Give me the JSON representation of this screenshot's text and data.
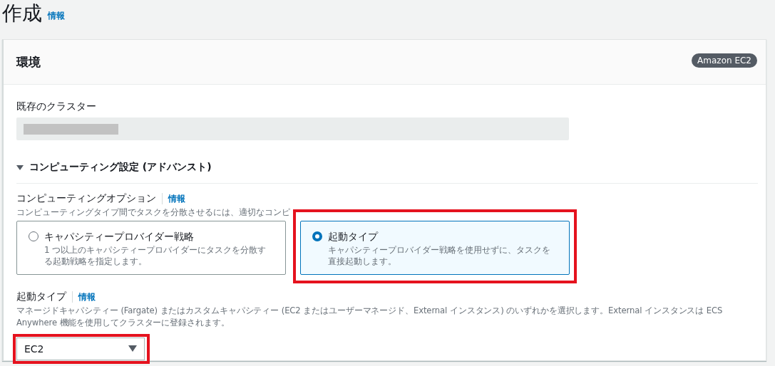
{
  "page": {
    "title": "作成",
    "info_link": "情報"
  },
  "panel": {
    "title": "環境",
    "badge": "Amazon EC2",
    "existing_cluster": {
      "label": "既存のクラスター",
      "value_redacted": true
    },
    "section": {
      "label": "コンピューティング設定 (アドバンスト)",
      "expanded": true
    },
    "compute_options": {
      "label": "コンピューティングオプション",
      "info_link": "情報",
      "description": "コンピューティングタイプ間でタスクを分散させるには、適切なコンピ",
      "options": [
        {
          "title": "キャパシティープロバイダー戦略",
          "description": "1 つ以上のキャパシティープロバイダーにタスクを分散する起動戦略を指定します。",
          "selected": false,
          "highlighted": false
        },
        {
          "title": "起動タイプ",
          "description": "キャパシティープロバイダー戦略を使用せずに、タスクを直接起動します。",
          "selected": true,
          "highlighted": true
        }
      ]
    },
    "launch_type": {
      "label": "起動タイプ",
      "info_link": "情報",
      "description": "マネージドキャパシティー (Fargate) またはカスタムキャパシティー (EC2 またはユーザーマネージド、External インスタンス) のいずれかを選択します。External インスタンスは ECS Anywhere 機能を使用してクラスターに登録されます。",
      "value": "EC2",
      "highlighted": true
    }
  }
}
